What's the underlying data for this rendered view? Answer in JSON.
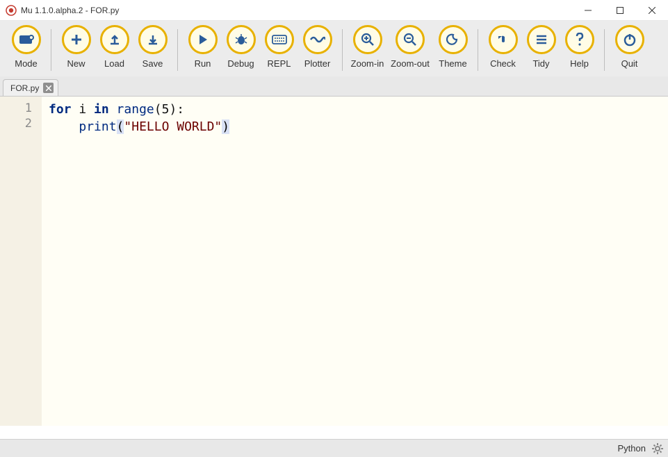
{
  "titlebar": {
    "title": "Mu 1.1.0.alpha.2 - FOR.py"
  },
  "toolbar": {
    "mode": "Mode",
    "new": "New",
    "load": "Load",
    "save": "Save",
    "run": "Run",
    "debug": "Debug",
    "repl": "REPL",
    "plotter": "Plotter",
    "zoomin": "Zoom-in",
    "zoomout": "Zoom-out",
    "theme": "Theme",
    "check": "Check",
    "tidy": "Tidy",
    "help": "Help",
    "quit": "Quit"
  },
  "tab": {
    "name": "FOR.py"
  },
  "gutter": {
    "l1": "1",
    "l2": "2"
  },
  "code": {
    "l1_for": "for",
    "l1_var": " i ",
    "l1_in": "in",
    "l1_fn": " range",
    "l1_lp": "(",
    "l1_arg": "5",
    "l1_rp": ")",
    "l1_colon": ":",
    "l2_indent": "    ",
    "l2_fn": "print",
    "l2_lp": "(",
    "l2_str": "\"HELLO WORLD\"",
    "l2_rp": ")"
  },
  "status": {
    "mode": "Python"
  }
}
